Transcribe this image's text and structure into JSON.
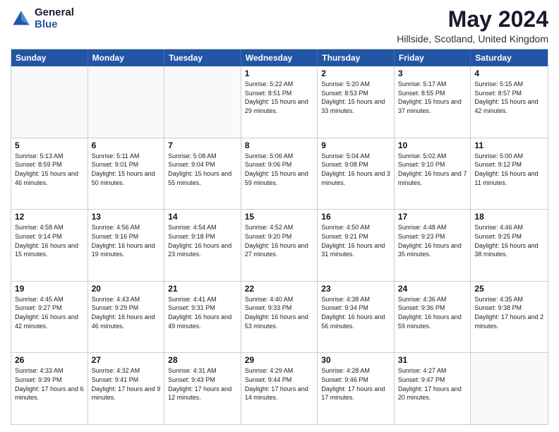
{
  "header": {
    "logo_general": "General",
    "logo_blue": "Blue",
    "title": "May 2024",
    "subtitle": "Hillside, Scotland, United Kingdom"
  },
  "calendar": {
    "days": [
      "Sunday",
      "Monday",
      "Tuesday",
      "Wednesday",
      "Thursday",
      "Friday",
      "Saturday"
    ],
    "rows": [
      [
        {
          "day": "",
          "text": ""
        },
        {
          "day": "",
          "text": ""
        },
        {
          "day": "",
          "text": ""
        },
        {
          "day": "1",
          "text": "Sunrise: 5:22 AM\nSunset: 8:51 PM\nDaylight: 15 hours and 29 minutes."
        },
        {
          "day": "2",
          "text": "Sunrise: 5:20 AM\nSunset: 8:53 PM\nDaylight: 15 hours and 33 minutes."
        },
        {
          "day": "3",
          "text": "Sunrise: 5:17 AM\nSunset: 8:55 PM\nDaylight: 15 hours and 37 minutes."
        },
        {
          "day": "4",
          "text": "Sunrise: 5:15 AM\nSunset: 8:57 PM\nDaylight: 15 hours and 42 minutes."
        }
      ],
      [
        {
          "day": "5",
          "text": "Sunrise: 5:13 AM\nSunset: 8:59 PM\nDaylight: 15 hours and 46 minutes."
        },
        {
          "day": "6",
          "text": "Sunrise: 5:11 AM\nSunset: 9:01 PM\nDaylight: 15 hours and 50 minutes."
        },
        {
          "day": "7",
          "text": "Sunrise: 5:08 AM\nSunset: 9:04 PM\nDaylight: 15 hours and 55 minutes."
        },
        {
          "day": "8",
          "text": "Sunrise: 5:06 AM\nSunset: 9:06 PM\nDaylight: 15 hours and 59 minutes."
        },
        {
          "day": "9",
          "text": "Sunrise: 5:04 AM\nSunset: 9:08 PM\nDaylight: 16 hours and 3 minutes."
        },
        {
          "day": "10",
          "text": "Sunrise: 5:02 AM\nSunset: 9:10 PM\nDaylight: 16 hours and 7 minutes."
        },
        {
          "day": "11",
          "text": "Sunrise: 5:00 AM\nSunset: 9:12 PM\nDaylight: 16 hours and 11 minutes."
        }
      ],
      [
        {
          "day": "12",
          "text": "Sunrise: 4:58 AM\nSunset: 9:14 PM\nDaylight: 16 hours and 15 minutes."
        },
        {
          "day": "13",
          "text": "Sunrise: 4:56 AM\nSunset: 9:16 PM\nDaylight: 16 hours and 19 minutes."
        },
        {
          "day": "14",
          "text": "Sunrise: 4:54 AM\nSunset: 9:18 PM\nDaylight: 16 hours and 23 minutes."
        },
        {
          "day": "15",
          "text": "Sunrise: 4:52 AM\nSunset: 9:20 PM\nDaylight: 16 hours and 27 minutes."
        },
        {
          "day": "16",
          "text": "Sunrise: 4:50 AM\nSunset: 9:21 PM\nDaylight: 16 hours and 31 minutes."
        },
        {
          "day": "17",
          "text": "Sunrise: 4:48 AM\nSunset: 9:23 PM\nDaylight: 16 hours and 35 minutes."
        },
        {
          "day": "18",
          "text": "Sunrise: 4:46 AM\nSunset: 9:25 PM\nDaylight: 16 hours and 38 minutes."
        }
      ],
      [
        {
          "day": "19",
          "text": "Sunrise: 4:45 AM\nSunset: 9:27 PM\nDaylight: 16 hours and 42 minutes."
        },
        {
          "day": "20",
          "text": "Sunrise: 4:43 AM\nSunset: 9:29 PM\nDaylight: 16 hours and 46 minutes."
        },
        {
          "day": "21",
          "text": "Sunrise: 4:41 AM\nSunset: 9:31 PM\nDaylight: 16 hours and 49 minutes."
        },
        {
          "day": "22",
          "text": "Sunrise: 4:40 AM\nSunset: 9:33 PM\nDaylight: 16 hours and 53 minutes."
        },
        {
          "day": "23",
          "text": "Sunrise: 4:38 AM\nSunset: 9:34 PM\nDaylight: 16 hours and 56 minutes."
        },
        {
          "day": "24",
          "text": "Sunrise: 4:36 AM\nSunset: 9:36 PM\nDaylight: 16 hours and 59 minutes."
        },
        {
          "day": "25",
          "text": "Sunrise: 4:35 AM\nSunset: 9:38 PM\nDaylight: 17 hours and 2 minutes."
        }
      ],
      [
        {
          "day": "26",
          "text": "Sunrise: 4:33 AM\nSunset: 9:39 PM\nDaylight: 17 hours and 6 minutes."
        },
        {
          "day": "27",
          "text": "Sunrise: 4:32 AM\nSunset: 9:41 PM\nDaylight: 17 hours and 9 minutes."
        },
        {
          "day": "28",
          "text": "Sunrise: 4:31 AM\nSunset: 9:43 PM\nDaylight: 17 hours and 12 minutes."
        },
        {
          "day": "29",
          "text": "Sunrise: 4:29 AM\nSunset: 9:44 PM\nDaylight: 17 hours and 14 minutes."
        },
        {
          "day": "30",
          "text": "Sunrise: 4:28 AM\nSunset: 9:46 PM\nDaylight: 17 hours and 17 minutes."
        },
        {
          "day": "31",
          "text": "Sunrise: 4:27 AM\nSunset: 9:47 PM\nDaylight: 17 hours and 20 minutes."
        },
        {
          "day": "",
          "text": ""
        }
      ]
    ]
  }
}
